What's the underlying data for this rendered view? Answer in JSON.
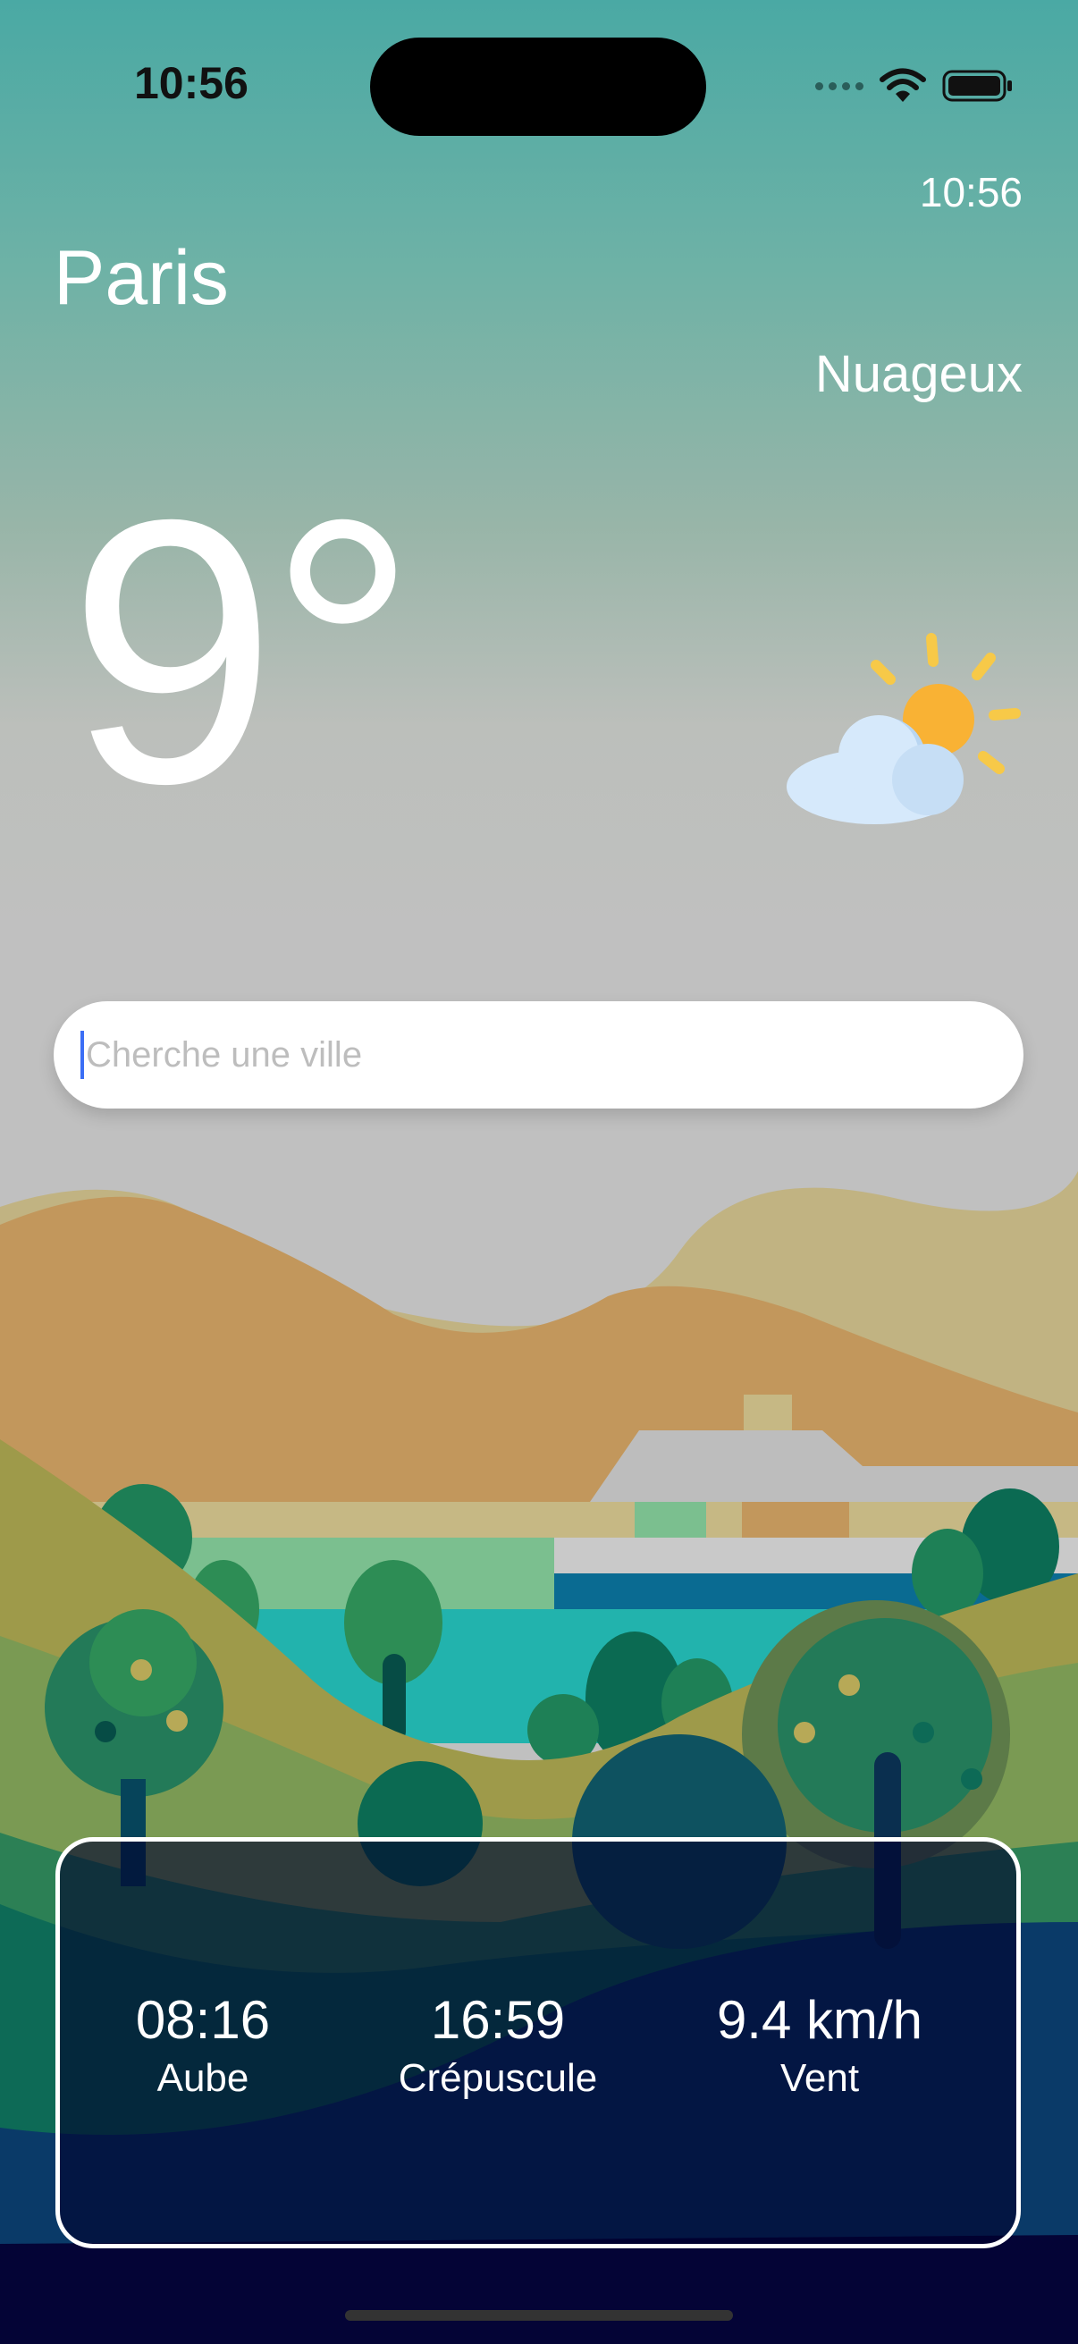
{
  "status_bar": {
    "time": "10:56"
  },
  "header": {
    "clock": "10:56",
    "city": "Paris",
    "condition": "Nuageux"
  },
  "weather": {
    "temperature": "9°",
    "icon": "partly-cloudy-icon"
  },
  "search": {
    "placeholder": "Cherche une ville",
    "value": ""
  },
  "stats": [
    {
      "value": "08:16",
      "label": "Aube"
    },
    {
      "value": "16:59",
      "label": "Crépuscule"
    },
    {
      "value": "9.4 km/h",
      "label": "Vent"
    }
  ],
  "colors": {
    "accent_caret": "#3b6ef5",
    "sun": "#f9b234",
    "cloud": "#d6e9fb",
    "night": "#040436"
  }
}
